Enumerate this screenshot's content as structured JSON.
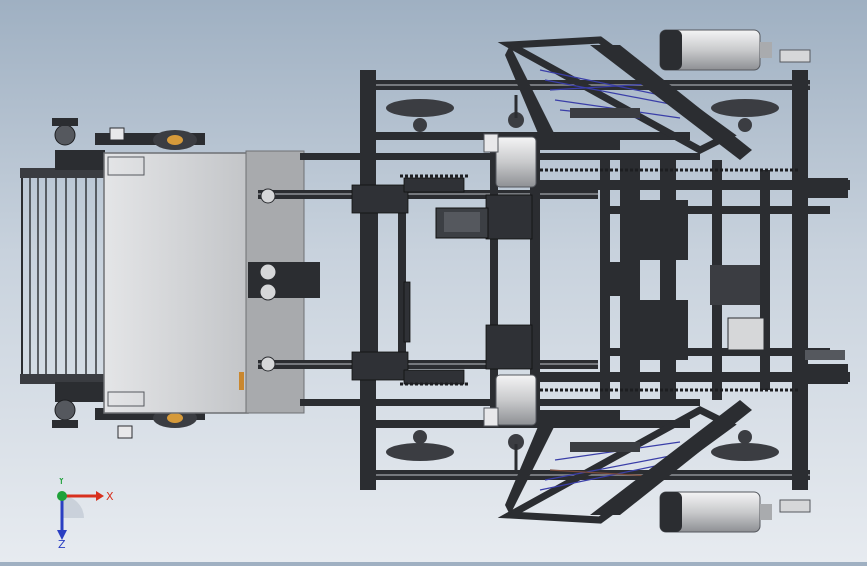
{
  "viewport": {
    "background_top": "#9fb0c2",
    "background_bottom": "#e7ebf0",
    "model_colors": {
      "frame": "#2b2d31",
      "frame_light": "#6d7076",
      "plate": "#d6d7d9",
      "plate_shadow": "#a9abae",
      "motor": "#e3e4e6",
      "belt": "#3a3ea8",
      "accent": "#c9872f"
    }
  },
  "triad": {
    "x_label": "X",
    "y_label": "Y",
    "z_label": "Z",
    "x_color": "#d8301e",
    "y_color": "#1fa13a",
    "z_color": "#2a3fc2"
  }
}
